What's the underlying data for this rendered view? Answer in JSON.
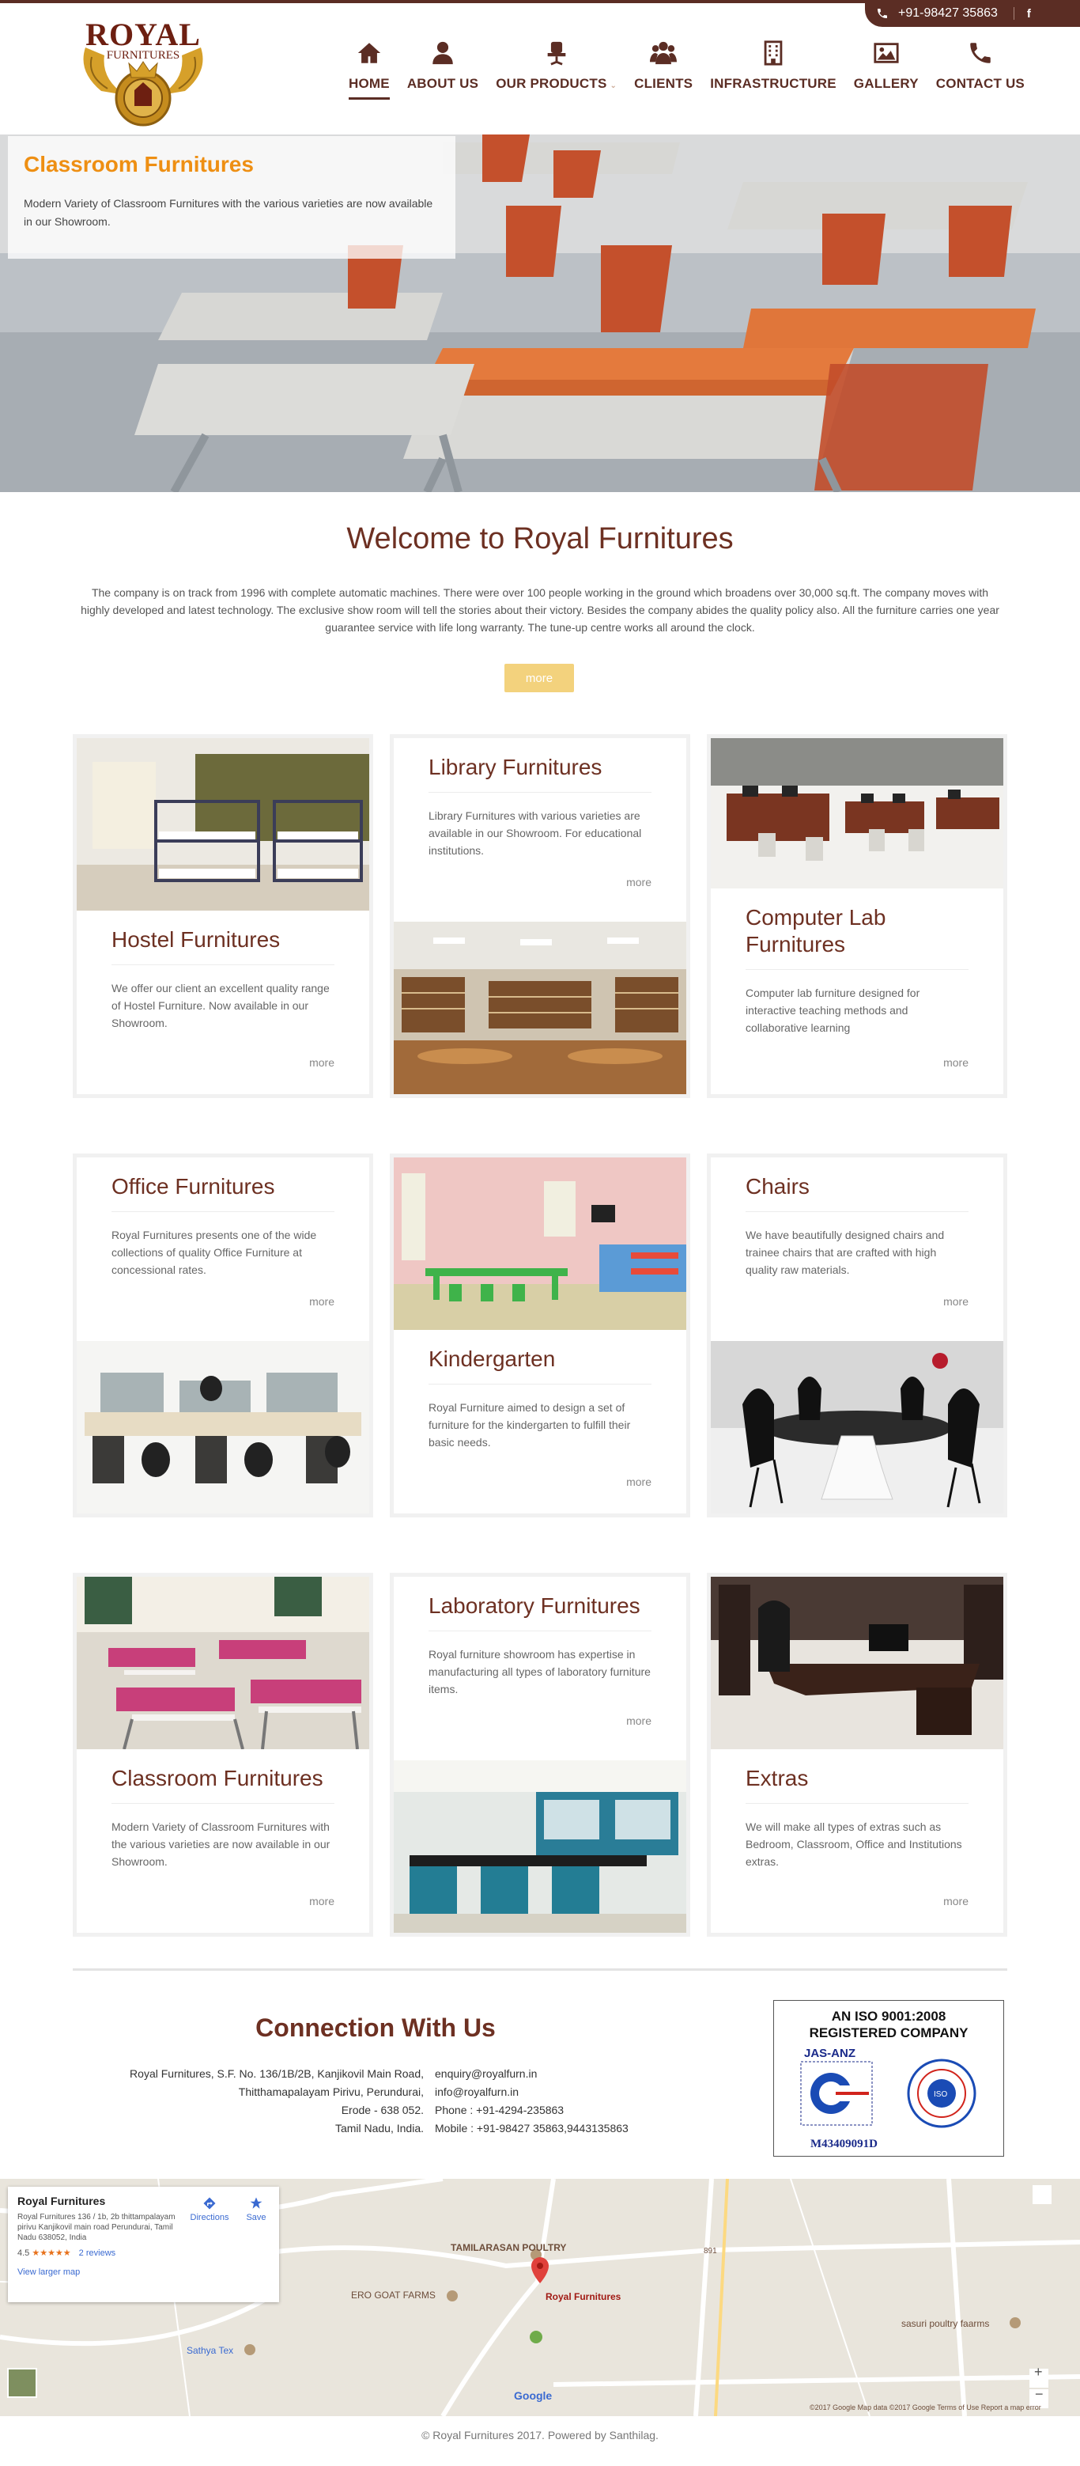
{
  "topbar": {
    "phone": "+91-98427 35863",
    "social": "f"
  },
  "logo": {
    "word": "ROYAL",
    "sub": "FURNITURES"
  },
  "nav": [
    {
      "label": "HOME",
      "icon": "home-icon",
      "active": true
    },
    {
      "label": "ABOUT US",
      "icon": "user-icon"
    },
    {
      "label": "OUR PRODUCTS",
      "icon": "chair-icon",
      "caret": "⌄"
    },
    {
      "label": "CLIENTS",
      "icon": "users-icon"
    },
    {
      "label": "INFRASTRUCTURE",
      "icon": "building-icon"
    },
    {
      "label": "GALLERY",
      "icon": "picture-icon"
    },
    {
      "label": "CONTACT US",
      "icon": "phone-icon"
    }
  ],
  "hero": {
    "title": "Classroom Furnitures",
    "text": "Modern Variety of Classroom Furnitures with the various varieties are now available in our Showroom."
  },
  "welcome": {
    "title": "Welcome to Royal Furnitures",
    "text": "The company is on track from 1996 with complete automatic machines. There were over 100 people working in the ground which broadens over 30,000 sq.ft. The company moves with highly developed and latest technology. The exclusive show room will tell the stories about their victory. Besides the company abides the quality policy also. All the furniture carries one year guarantee service with life long warranty. The tune-up centre works all around the clock.",
    "button": "more"
  },
  "cards": [
    {
      "title": "Hostel Furnitures",
      "text": "We offer our client an excellent quality range of Hostel Furniture. Now available in  our Showroom.",
      "more": "more"
    },
    {
      "title": "Library Furnitures",
      "text": "Library Furnitures with various varieties are available in our Showroom. For educational institutions.",
      "more": "more"
    },
    {
      "title": "Computer Lab Furnitures",
      "text": "Computer lab furniture designed for interactive teaching methods and collaborative learning",
      "more": "more"
    },
    {
      "title": "Office Furnitures",
      "text": "Royal Furnitures presents one of the wide collections of quality Office Furniture at concessional rates.",
      "more": "more"
    },
    {
      "title": "Kindergarten",
      "text": "Royal Furniture  aimed to design a set of furniture for the kindergarten to fulfill their basic needs.",
      "more": "more"
    },
    {
      "title": "Chairs",
      "text": "We have beautifully designed chairs and trainee chairs that are crafted with high quality raw materials.",
      "more": "more"
    },
    {
      "title": "Classroom Furnitures",
      "text": "Modern Variety of Classroom Furnitures with the various varieties are now available in our Showroom.",
      "more": "more"
    },
    {
      "title": "Laboratory Furnitures",
      "text": "Royal furniture showroom has expertise in manufacturing all types of laboratory furniture items.",
      "more": "more"
    },
    {
      "title": "Extras",
      "text": "We will make all types of extras such as Bedroom, Classroom, Office and Institutions extras.",
      "more": "more"
    }
  ],
  "connection": {
    "title": "Connection With Us",
    "address": [
      "Royal Furnitures, S.F. No. 136/1B/2B, Kanjikovil Main Road,",
      "Thitthamapalayam Pirivu, Perundurai,",
      "Erode - 638 052.",
      "Tamil Nadu, India."
    ],
    "contacts": [
      "enquiry@royalfurn.in",
      "info@royalfurn.in",
      "Phone : +91-4294-235863",
      "Mobile : +91-98427 35863,9443135863"
    ]
  },
  "iso": {
    "line1": "AN ISO 9001:2008",
    "line2": "REGISTERED COMPANY",
    "badge": "JAS-ANZ",
    "code": "M43409091D"
  },
  "map": {
    "place": "Royal Furnitures",
    "address": "Royal Furnitures 136 / 1b, 2b thittampalayam pirivu Kanjikovil main road Perundurai, Tamil Nadu 638052, India",
    "rating": "4.5",
    "stars": "★★★★★",
    "reviews": "2 reviews",
    "larger": "View larger map",
    "directions": "Directions",
    "save": "Save",
    "labels": [
      "TAMILARASAN POULTRY",
      "Royal Furnitures",
      "ERO GOAT FARMS",
      "Sathya Tex",
      "sasuri poultry faarms",
      "Google",
      "891"
    ],
    "attribution": "©2017 Google   Map data ©2017 Google   Terms of Use   Report a map error"
  },
  "footer": "© Royal Furnitures 2017. Powered by Santhilag."
}
